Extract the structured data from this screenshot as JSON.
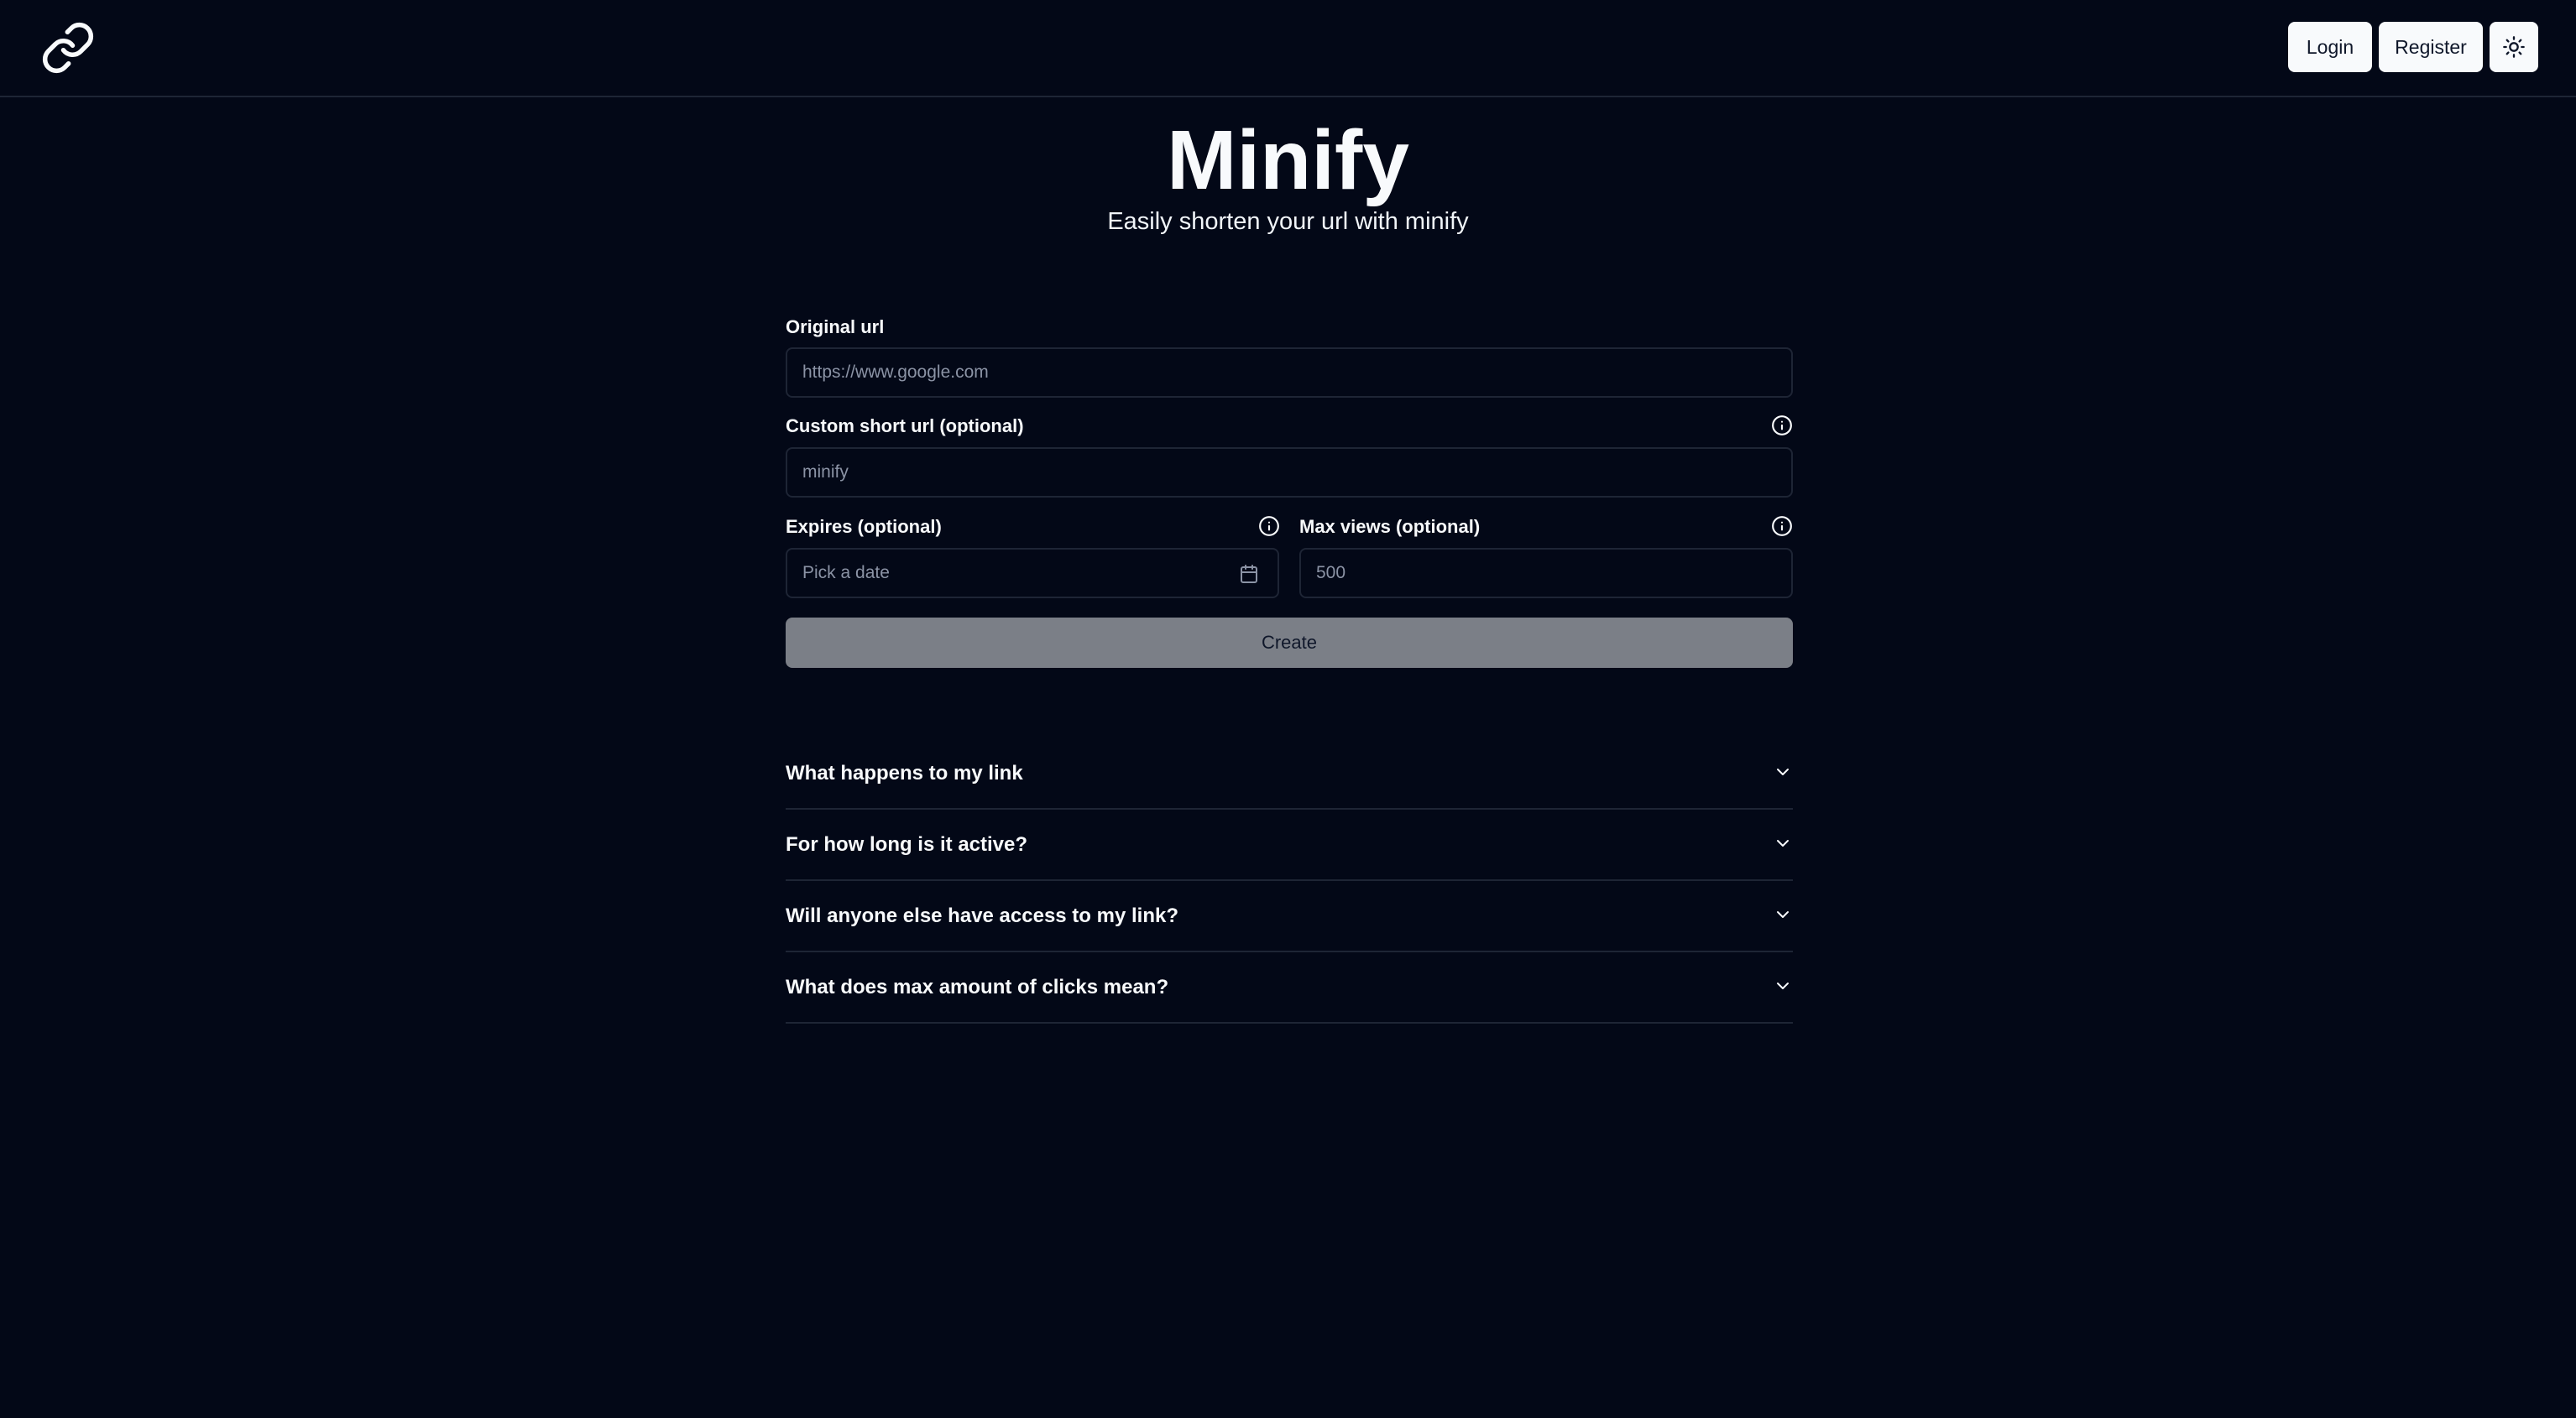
{
  "header": {
    "logo_icon": "link-icon",
    "login_label": "Login",
    "register_label": "Register",
    "theme_icon": "sun-icon"
  },
  "hero": {
    "title": "Minify",
    "subtitle": "Easily shorten your url with minify"
  },
  "form": {
    "original_url": {
      "label": "Original url",
      "placeholder": "https://www.google.com",
      "value": ""
    },
    "custom_short": {
      "label": "Custom short url (optional)",
      "placeholder": "minify",
      "value": ""
    },
    "expires": {
      "label": "Expires (optional)",
      "placeholder": "Pick a date"
    },
    "max_views": {
      "label": "Max views (optional)",
      "placeholder": "500",
      "value": ""
    },
    "create_label": "Create"
  },
  "faq": [
    {
      "question": "What happens to my link"
    },
    {
      "question": "For how long is it active?"
    },
    {
      "question": "Will anyone else have access to my link?"
    },
    {
      "question": "What does max amount of clicks mean?"
    }
  ],
  "colors": {
    "background": "#030817",
    "border": "#1e2535",
    "button_light": "#f8fafc",
    "create_disabled": "#7b7f87"
  }
}
